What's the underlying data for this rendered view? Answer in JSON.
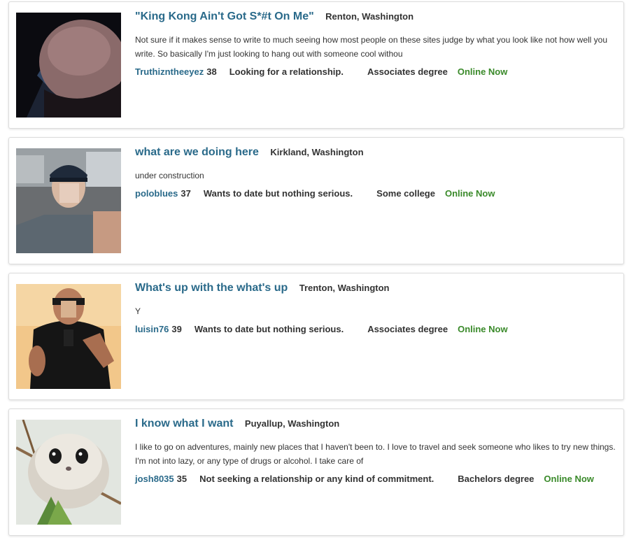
{
  "profiles": [
    {
      "headline": "\"King Kong Ain't Got S*#t On Me\"",
      "location": "Renton, Washington",
      "about": "Not sure if it makes sense to write to much seeing how most people on these sites judge by what you look like not how well you write. So basically I'm just looking to hang out with someone cool withou",
      "username": "Truthizntheeyez",
      "age": "38",
      "intent": "Looking for a relationship.",
      "education": "Associates degree",
      "status": "Online Now",
      "photo_icon": "profile-photo-dark-head"
    },
    {
      "headline": "what are we doing here",
      "location": "Kirkland, Washington",
      "about": "under construction",
      "username": "poloblues",
      "age": "37",
      "intent": "Wants to date but nothing serious.",
      "education": "Some college",
      "status": "Online Now",
      "photo_icon": "profile-photo-car-selfie"
    },
    {
      "headline": "What's up with the what's up",
      "location": "Trenton, Washington",
      "about": "Y",
      "username": "luisin76",
      "age": "39",
      "intent": "Wants to date but nothing serious.",
      "education": "Associates degree",
      "status": "Online Now",
      "photo_icon": "profile-photo-mirror-selfie"
    },
    {
      "headline": "I know what I want",
      "location": "Puyallup, Washington",
      "about": "I like to go on adventures, mainly new places that I haven't been to. I love to travel and seek someone who likes to try new things. I'm not into lazy, or any type of drugs or alcohol. I take care of",
      "username": "josh8035",
      "age": "35",
      "intent": "Not seeking a relationship or any kind of commitment.",
      "education": "Bachelors degree",
      "status": "Online Now",
      "photo_icon": "profile-photo-flying-squirrel"
    }
  ],
  "colors": {
    "link": "#2a6a8a",
    "online": "#3a8a2a",
    "text": "#333333",
    "border": "#dcdcdc"
  }
}
